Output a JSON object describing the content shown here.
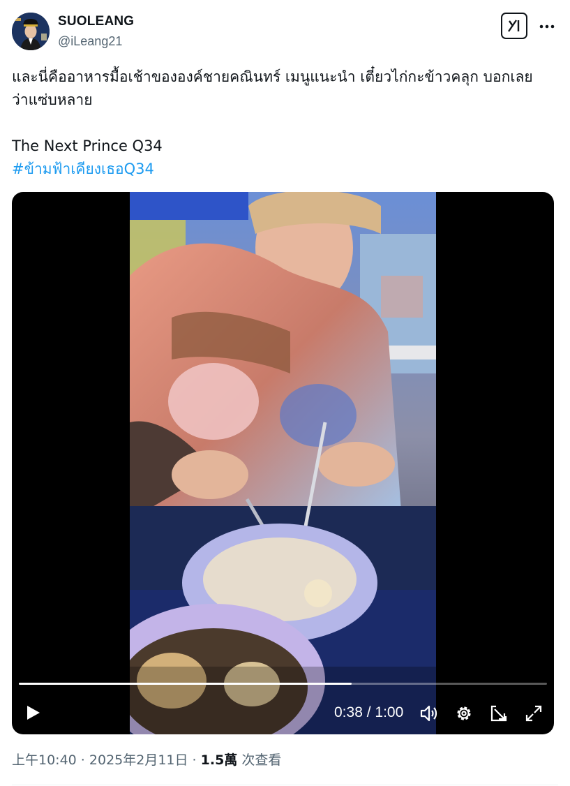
{
  "author": {
    "display_name": "SUOLEANG",
    "handle": "@iLeang21",
    "avatar_icon": "profile-photo"
  },
  "header_actions": {
    "grok_icon": "grok-icon",
    "more_icon": "more-dots-icon"
  },
  "tweet": {
    "line1": "และนี่คืออาหารมื้อเช้าขององค์ชายคณินทร์ เมนูแนะนำ เตี๋ยวไก่กะข้าวคลุก บอกเลย",
    "line2": "ว่าแซ่บหลาย",
    "line3": "The Next Prince Q34",
    "hashtag": "#ข้ามฟ้าเคียงเธอQ34",
    "hashtag_color": "#1d9bf0"
  },
  "video": {
    "current_time": "0:38",
    "separator": " / ",
    "duration": "1:00",
    "progress": 0.63,
    "controls": [
      "play-icon",
      "volume-icon",
      "settings-icon",
      "pip-icon",
      "fullscreen-icon"
    ]
  },
  "meta": {
    "time": "上午10:40",
    "dot1": " · ",
    "date": "2025年2月11日",
    "dot2": " · ",
    "views_count": "1.5萬",
    "views_label": " 次查看"
  }
}
